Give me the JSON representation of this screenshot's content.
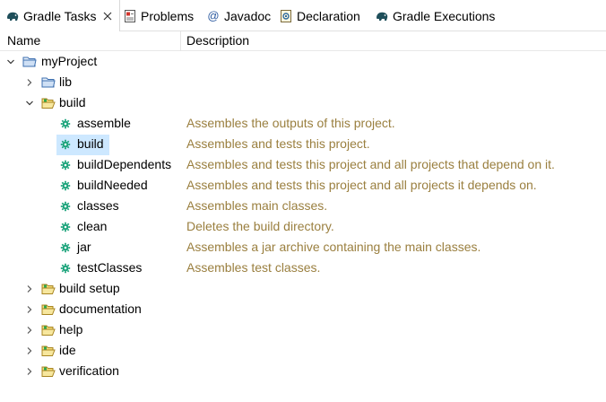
{
  "tabs": [
    {
      "label": "Gradle Tasks",
      "icon": "gradle-elephant-icon",
      "active": true
    },
    {
      "label": "Problems",
      "icon": "problems-icon"
    },
    {
      "label": "Javadoc",
      "icon": "at-sign-icon"
    },
    {
      "label": "Declaration",
      "icon": "declaration-icon"
    },
    {
      "label": "Gradle Executions",
      "icon": "gradle-elephant-icon"
    }
  ],
  "columns": {
    "name": "Name",
    "description": "Description"
  },
  "colors": {
    "description_text": "#9a7f3f",
    "selection": "#cde8ff",
    "task_icon": "#1aa37a"
  },
  "tree": {
    "project": {
      "label": "myProject",
      "expanded": true
    },
    "lib": {
      "label": "lib"
    },
    "build_folder": {
      "label": "build"
    },
    "tasks": [
      {
        "label": "assemble",
        "description": "Assembles the outputs of this project."
      },
      {
        "label": "build",
        "description": "Assembles and tests this project.",
        "selected": true
      },
      {
        "label": "buildDependents",
        "description": "Assembles and tests this project and all projects that depend on it."
      },
      {
        "label": "buildNeeded",
        "description": "Assembles and tests this project and all projects it depends on."
      },
      {
        "label": "classes",
        "description": "Assembles main classes."
      },
      {
        "label": "clean",
        "description": "Deletes the build directory."
      },
      {
        "label": "jar",
        "description": "Assembles a jar archive containing the main classes."
      },
      {
        "label": "testClasses",
        "description": "Assembles test classes."
      }
    ],
    "groups": [
      {
        "label": "build setup"
      },
      {
        "label": "documentation"
      },
      {
        "label": "help"
      },
      {
        "label": "ide"
      },
      {
        "label": "verification"
      }
    ]
  }
}
